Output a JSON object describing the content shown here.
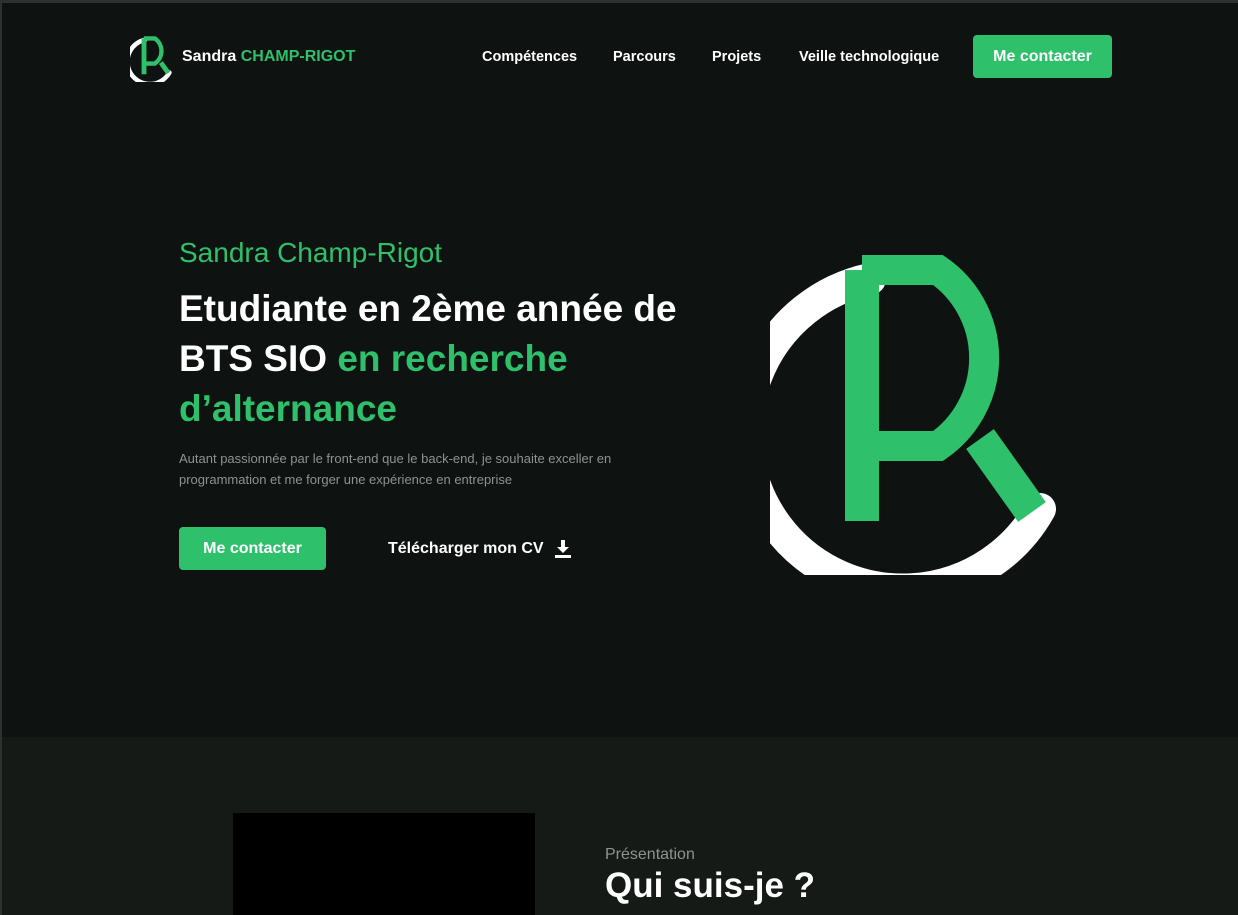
{
  "header": {
    "brand_first": "Sandra",
    "brand_last": "CHAMP-RIGOT",
    "nav": [
      {
        "label": "Compétences"
      },
      {
        "label": "Parcours"
      },
      {
        "label": "Projets"
      },
      {
        "label": "Veille technologique"
      }
    ],
    "cta_label": "Me contacter"
  },
  "hero": {
    "name": "Sandra Champ-Rigot",
    "title_white": "Etudiante en 2ème année de BTS SIO ",
    "title_accent": "en recherche d’alternance",
    "description": "Autant passionnée par le front-end que le back-end, je souhaite exceller en programmation et me forger une expérience en entreprise",
    "cta_label": "Me contacter",
    "download_label": "Télécharger mon CV",
    "download_icon": "download-icon"
  },
  "about": {
    "eyebrow": "Présentation",
    "title": "Qui suis-je ?"
  },
  "colors": {
    "accent": "#2fc06b",
    "background": "#0e1311",
    "section_background": "#151a17",
    "text": "#ffffff",
    "muted": "#8b948f"
  }
}
